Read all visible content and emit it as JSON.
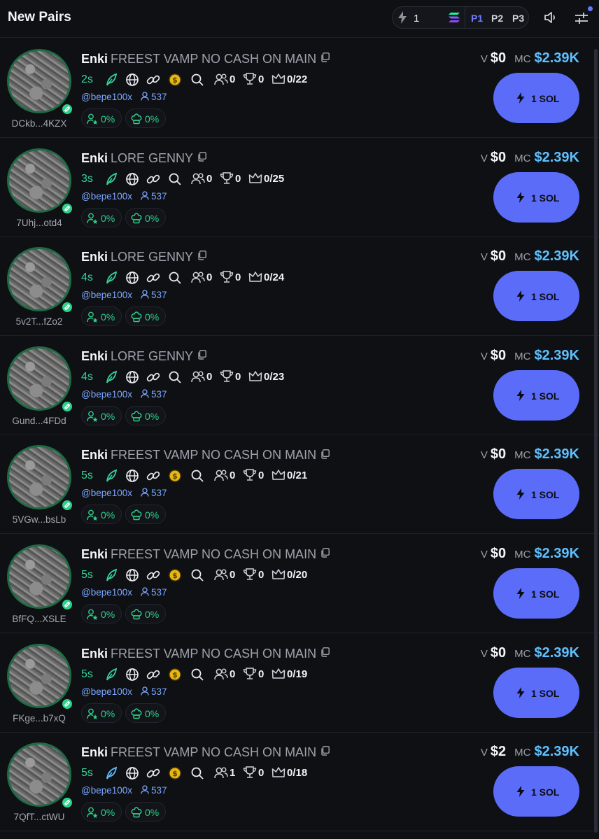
{
  "header": {
    "title": "New Pairs",
    "quick_buy_amount": "1",
    "presets": [
      "P1",
      "P2",
      "P3"
    ],
    "active_preset": "P1",
    "icons": [
      "bolt-icon",
      "solana-icon",
      "speaker-icon",
      "sliders-icon"
    ],
    "accent_color": "#5b6cf9"
  },
  "rows": [
    {
      "ticker": "Enki",
      "name": "FREEST VAMP NO CASH ON MAIN",
      "address": "DCkb...4KZX",
      "age": "2s",
      "has_dex_icon": true,
      "holders": "0",
      "trophies": "0",
      "crown": "0/22",
      "handle": "@bepe100x",
      "followers": "537",
      "pct1": "0%",
      "pct2": "0%",
      "volume": "$0",
      "mc": "$2.39K",
      "buy_label": "1 SOL"
    },
    {
      "ticker": "Enki",
      "name": "LORE GENNY",
      "address": "7Uhj...otd4",
      "age": "3s",
      "has_dex_icon": false,
      "holders": "0",
      "trophies": "0",
      "crown": "0/25",
      "handle": "@bepe100x",
      "followers": "537",
      "pct1": "0%",
      "pct2": "0%",
      "volume": "$0",
      "mc": "$2.39K",
      "buy_label": "1 SOL"
    },
    {
      "ticker": "Enki",
      "name": "LORE GENNY",
      "address": "5v2T...fZo2",
      "age": "4s",
      "has_dex_icon": false,
      "holders": "0",
      "trophies": "0",
      "crown": "0/24",
      "handle": "@bepe100x",
      "followers": "537",
      "pct1": "0%",
      "pct2": "0%",
      "volume": "$0",
      "mc": "$2.39K",
      "buy_label": "1 SOL"
    },
    {
      "ticker": "Enki",
      "name": "LORE GENNY",
      "address": "Gund...4FDd",
      "age": "4s",
      "has_dex_icon": false,
      "holders": "0",
      "trophies": "0",
      "crown": "0/23",
      "handle": "@bepe100x",
      "followers": "537",
      "pct1": "0%",
      "pct2": "0%",
      "volume": "$0",
      "mc": "$2.39K",
      "buy_label": "1 SOL"
    },
    {
      "ticker": "Enki",
      "name": "FREEST VAMP NO CASH ON MAIN",
      "address": "5VGw...bsLb",
      "age": "5s",
      "has_dex_icon": true,
      "holders": "0",
      "trophies": "0",
      "crown": "0/21",
      "handle": "@bepe100x",
      "followers": "537",
      "pct1": "0%",
      "pct2": "0%",
      "volume": "$0",
      "mc": "$2.39K",
      "buy_label": "1 SOL"
    },
    {
      "ticker": "Enki",
      "name": "FREEST VAMP NO CASH ON MAIN",
      "address": "BfFQ...XSLE",
      "age": "5s",
      "has_dex_icon": true,
      "holders": "0",
      "trophies": "0",
      "crown": "0/20",
      "handle": "@bepe100x",
      "followers": "537",
      "pct1": "0%",
      "pct2": "0%",
      "volume": "$0",
      "mc": "$2.39K",
      "buy_label": "1 SOL"
    },
    {
      "ticker": "Enki",
      "name": "FREEST VAMP NO CASH ON MAIN",
      "address": "FKge...b7xQ",
      "age": "5s",
      "has_dex_icon": true,
      "holders": "0",
      "trophies": "0",
      "crown": "0/19",
      "handle": "@bepe100x",
      "followers": "537",
      "pct1": "0%",
      "pct2": "0%",
      "volume": "$0",
      "mc": "$2.39K",
      "buy_label": "1 SOL"
    },
    {
      "ticker": "Enki",
      "name": "FREEST VAMP NO CASH ON MAIN",
      "address": "7QfT...ctWU",
      "age": "5s",
      "has_dex_icon": true,
      "holders": "1",
      "trophies": "0",
      "crown": "0/18",
      "handle": "@bepe100x",
      "followers": "537",
      "pct1": "0%",
      "pct2": "0%",
      "volume": "$2",
      "mc": "$2.39K",
      "buy_label": "1 SOL"
    }
  ],
  "labels": {
    "volume": "V",
    "market_cap": "MC"
  },
  "colors": {
    "green": "#34d399",
    "mc": "#5fc0ff",
    "button": "#5b6cf9"
  }
}
